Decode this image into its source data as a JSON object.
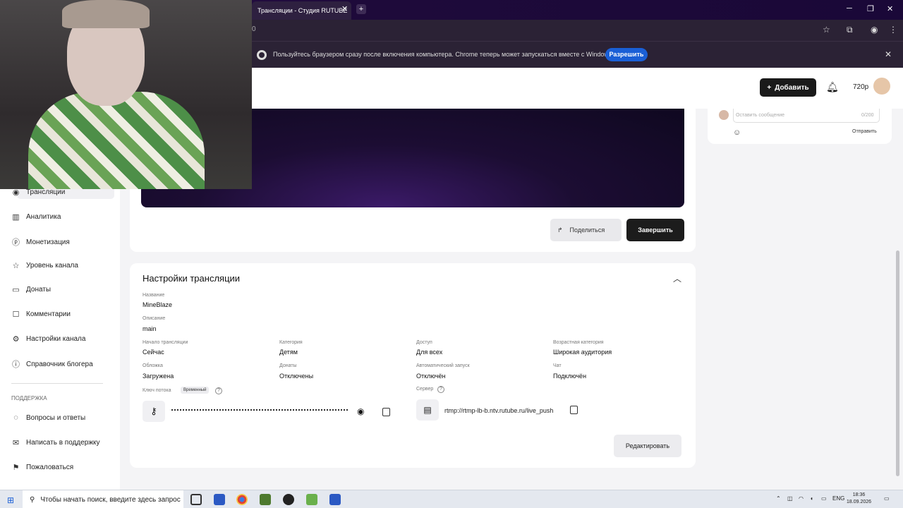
{
  "browser": {
    "tab_title": "Трансляции - Студия RUTUBE",
    "tab_close": "✕",
    "new_tab": "+",
    "address_fragment": "0",
    "infobar_text": "Пользуйтесь браузером сразу после включения компьютера. Chrome теперь может запускаться вместе с Windows.",
    "infobar_allow": "Разрешить",
    "infobar_close": "✕"
  },
  "header": {
    "add_label": "Добавить",
    "quality": "720p"
  },
  "sidebar": {
    "items": [
      {
        "label": "Трансляции",
        "icon": "broadcast-icon"
      },
      {
        "label": "Аналитика",
        "icon": "analytics-icon"
      },
      {
        "label": "Монетизация",
        "icon": "monetization-icon"
      },
      {
        "label": "Уровень канала",
        "icon": "star-icon"
      },
      {
        "label": "Донаты",
        "icon": "donate-icon"
      },
      {
        "label": "Комментарии",
        "icon": "comments-icon"
      },
      {
        "label": "Настройки канала",
        "icon": "gear-icon"
      },
      {
        "label": "Справочник блогера",
        "icon": "help-icon"
      }
    ],
    "support_header": "ПОДДЕРЖКА",
    "support_items": [
      {
        "label": "Вопросы и ответы",
        "icon": "faq-icon"
      },
      {
        "label": "Написать в поддержку",
        "icon": "mail-icon"
      },
      {
        "label": "Пожаловаться",
        "icon": "flag-icon"
      }
    ]
  },
  "player": {
    "share_label": "Поделиться",
    "finish_label": "Завершить"
  },
  "settings": {
    "title": "Настройки трансляции",
    "name_label": "Название",
    "name_value": "MineBlaze",
    "desc_label": "Описание",
    "desc_value": "main",
    "start_label": "Начало трансляции",
    "start_value": "Сейчас",
    "category_label": "Категория",
    "category_value": "Детям",
    "access_label": "Доступ",
    "access_value": "Для всех",
    "age_label": "Возрастная категория",
    "age_value": "Широкая аудитория",
    "cover_label": "Обложка",
    "cover_value": "Загружена",
    "donates_label": "Донаты",
    "donates_value": "Отключены",
    "autostart_label": "Автоматический запуск",
    "autostart_value": "Отключён",
    "chat_label": "Чат",
    "chat_value": "Подключён",
    "key_label": "Ключ потока",
    "key_badge": "Временный",
    "server_label": "Сервер",
    "server_url": "rtmp://rtmp-lb-b.ntv.rutube.ru/live_push",
    "edit_label": "Редактировать"
  },
  "chat": {
    "placeholder": "Оставить сообщение",
    "counter": "0/200",
    "send_label": "Отправить"
  },
  "taskbar": {
    "search_placeholder": "Чтобы начать поиск, введите здесь запрос",
    "lang": "ENG",
    "time": "18:36",
    "date": "18.09.2026"
  },
  "colors": {
    "accent": "#1a5fd6",
    "dark_button": "#1c1c1c",
    "video_bg": "#1c0d33"
  }
}
